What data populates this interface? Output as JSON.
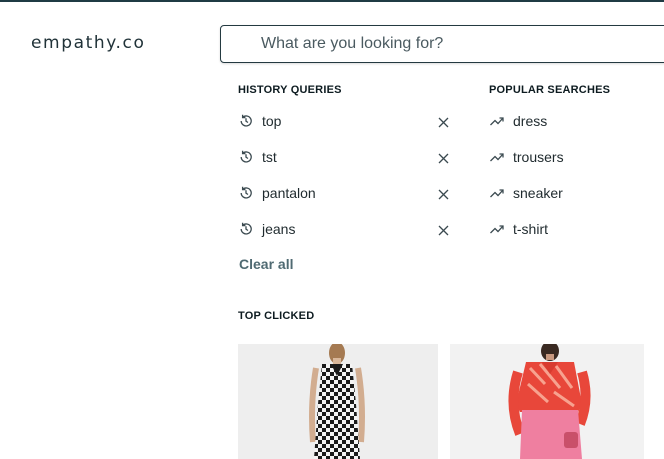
{
  "brand": {
    "logo_text": "empathy.co"
  },
  "search": {
    "placeholder": "What are you looking for?",
    "value": ""
  },
  "history": {
    "title": "HISTORY QUERIES",
    "items": [
      {
        "label": "top",
        "icon": "history-icon"
      },
      {
        "label": "tst",
        "icon": "history-icon"
      },
      {
        "label": "pantalon",
        "icon": "history-icon"
      },
      {
        "label": "jeans",
        "icon": "history-icon"
      }
    ],
    "clear_label": "Clear all"
  },
  "popular": {
    "title": "POPULAR SEARCHES",
    "items": [
      {
        "label": "dress",
        "icon": "trending-icon"
      },
      {
        "label": "trousers",
        "icon": "trending-icon"
      },
      {
        "label": "sneaker",
        "icon": "trending-icon"
      },
      {
        "label": "t-shirt",
        "icon": "trending-icon"
      }
    ]
  },
  "top_clicked": {
    "title": "TOP CLICKED",
    "products": [
      {
        "image": "checkered-dress-product-image"
      },
      {
        "image": "red-blouse-pink-skirt-product-image"
      }
    ]
  },
  "colors": {
    "accent": "#1f3b44",
    "clear_link": "#4f6a72"
  }
}
